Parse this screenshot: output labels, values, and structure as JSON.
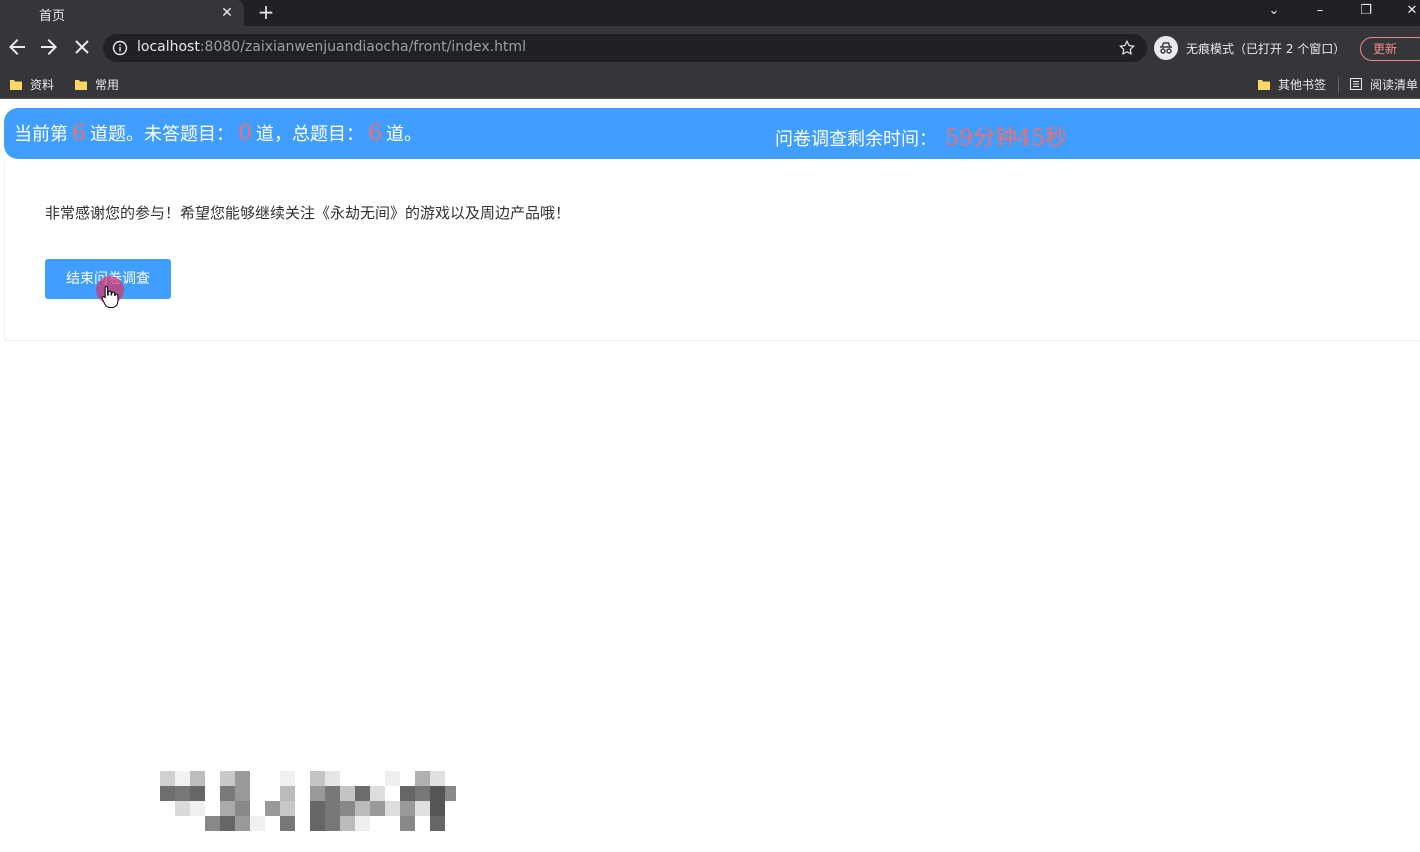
{
  "browser": {
    "tab_title": "首页",
    "new_tab_label": "+",
    "url_host": "localhost",
    "url_path": ":8080/zaixianwenjuandiaocha/front/index.html",
    "incognito_label": "无痕模式（已打开 2 个窗口）",
    "update_label": "更新",
    "bookmarks": [
      {
        "label": "资料"
      },
      {
        "label": "常用"
      },
      {
        "label": "其他书签"
      },
      {
        "label": "阅读清单"
      }
    ],
    "colors": {
      "accent_update": "#f28b82",
      "folder": "#fdd663"
    }
  },
  "status": {
    "current_prefix": "当前第",
    "current_num": "6",
    "current_suffix": "道题。未答题目：",
    "unanswered_num": "0",
    "unanswered_suffix": "道，总题目：",
    "total_num": "6",
    "total_suffix": "道。",
    "time_label": "问卷调查剩余时间：",
    "time_value": "59分钟45秒",
    "colors": {
      "bar": "#409eff",
      "highlight": "#f56c6c"
    }
  },
  "main": {
    "thanks_text": "非常感谢您的参与！希望您能够继续关注《永劫无间》的游戏以及周边产品哦！",
    "end_button_label": "结束问卷调查"
  }
}
